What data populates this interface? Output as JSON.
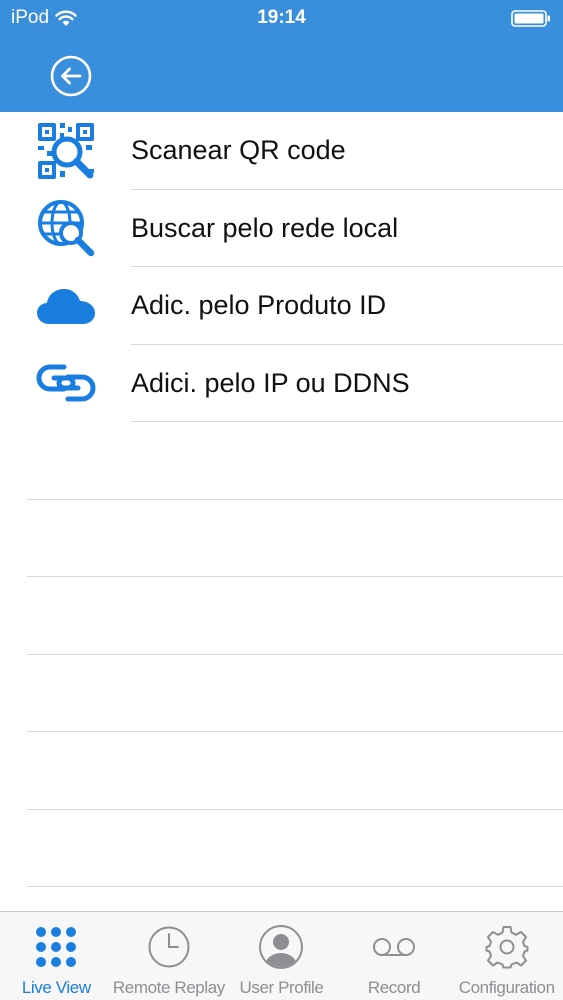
{
  "status_bar": {
    "carrier": "iPod",
    "time": "19:14"
  },
  "colors": {
    "header": "#3a8fdc",
    "accent": "#1a7ee0",
    "inactive": "#8e8e93"
  },
  "menu": {
    "items": [
      {
        "label": "Scanear QR code",
        "icon": "qr-scan-icon"
      },
      {
        "label": "Buscar pelo rede local",
        "icon": "globe-search-icon"
      },
      {
        "label": "Adic. pelo Produto ID",
        "icon": "cloud-icon"
      },
      {
        "label": "Adici. pelo IP ou DDNS",
        "icon": "link-icon"
      }
    ]
  },
  "tab_bar": {
    "tabs": [
      {
        "label": "Live View",
        "icon": "grid-dots-icon",
        "active": true
      },
      {
        "label": "Remote Replay",
        "icon": "clock-icon",
        "active": false
      },
      {
        "label": "User Profile",
        "icon": "user-icon",
        "active": false
      },
      {
        "label": "Record",
        "icon": "voicemail-icon",
        "active": false
      },
      {
        "label": "Configuration",
        "icon": "gear-icon",
        "active": false
      }
    ]
  }
}
